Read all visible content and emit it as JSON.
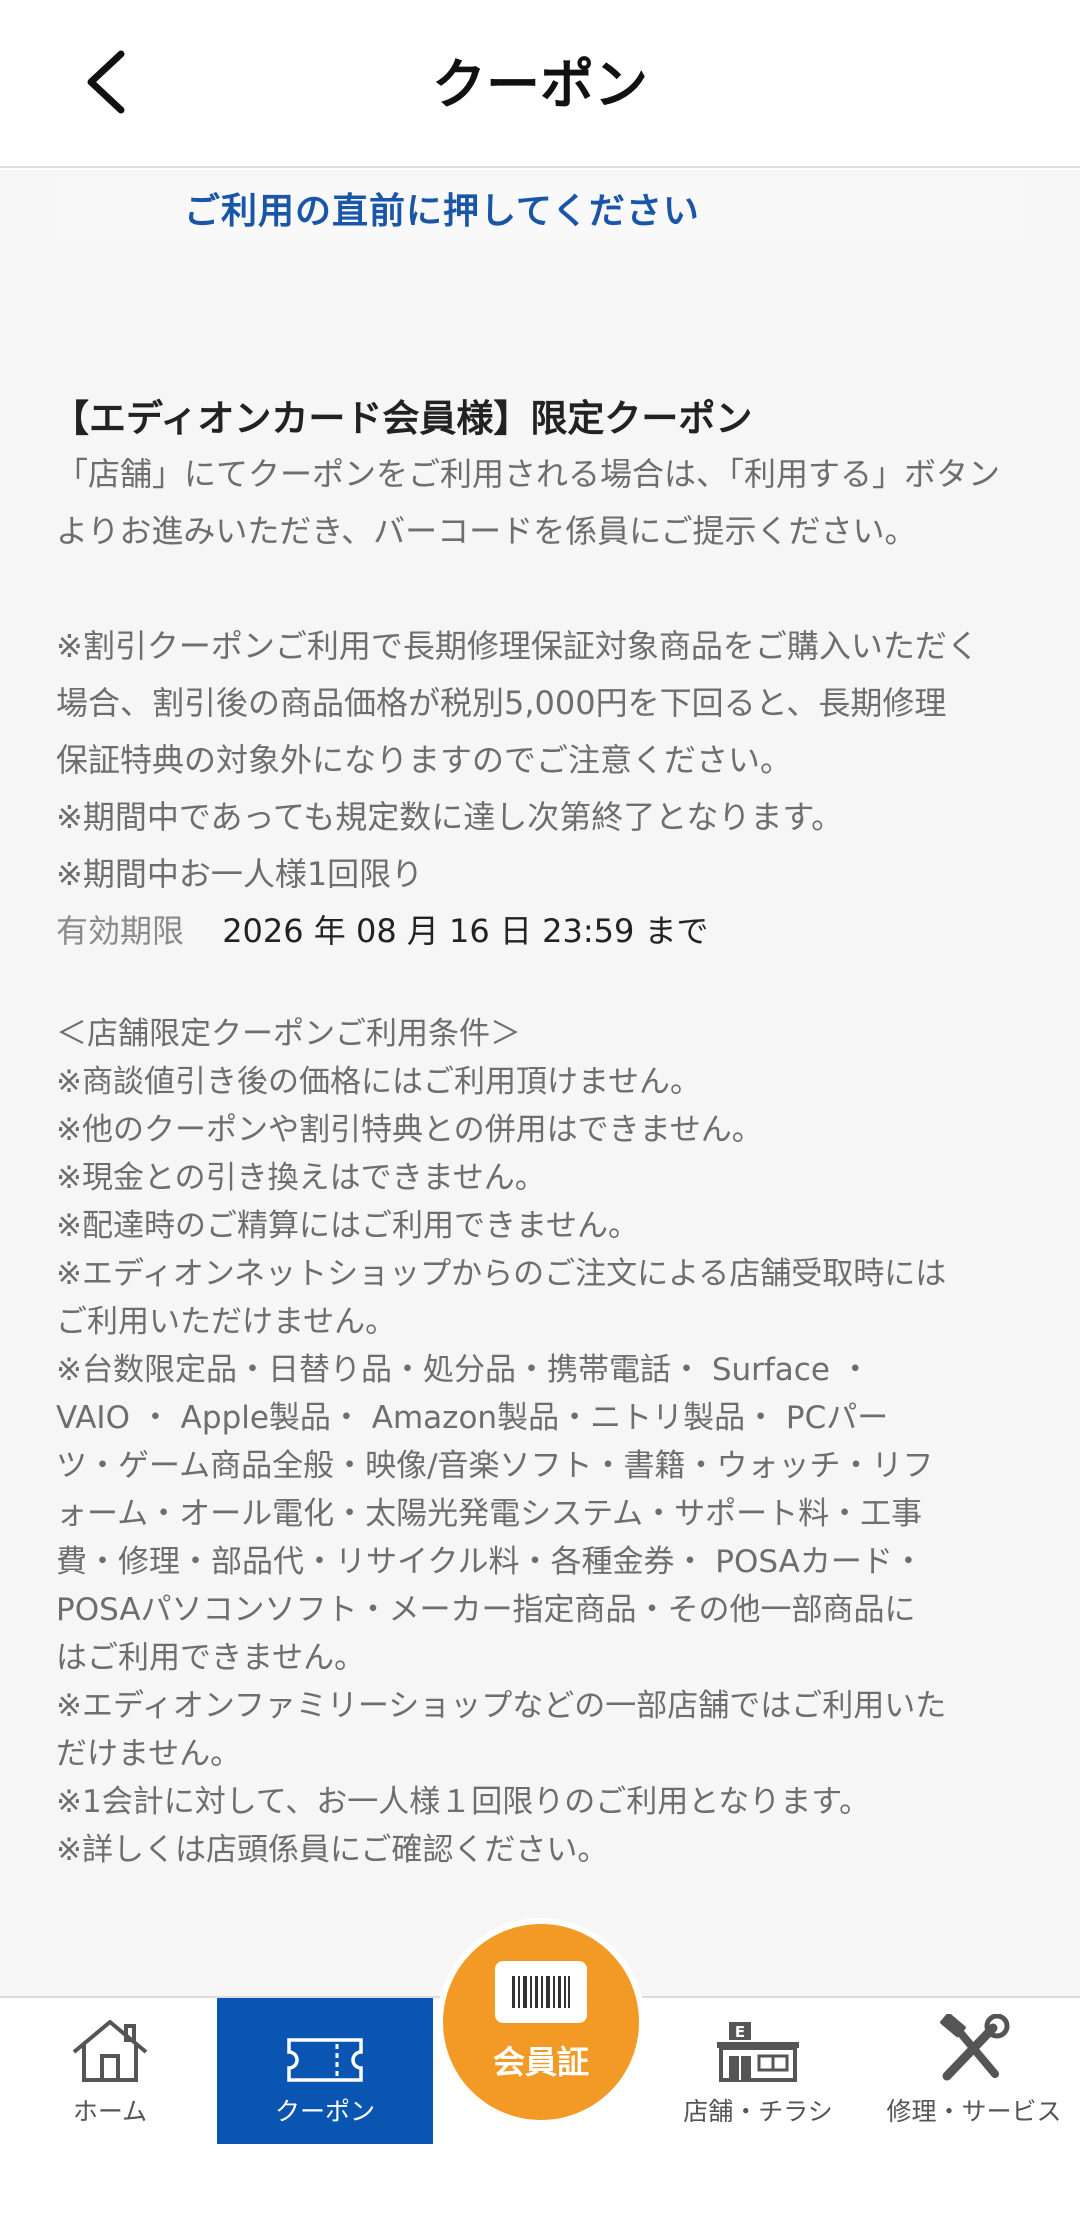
{
  "header": {
    "title": "クーポン",
    "back_icon": "chevron-left-icon"
  },
  "banner": {
    "text": "ご利用の直前に押してください"
  },
  "coupon": {
    "title": "【エディオンカード会員様】限定クーポン",
    "description_lines": [
      "「店舗」にてクーポンをご利用される場合は、「利用する」ボタン",
      "よりお進みいただき、バーコードを係員にご提示ください。"
    ],
    "notes_lines": [
      "※割引クーポンご利用で長期修理保証対象商品をご購入いただく",
      "場合、割引後の商品価格が税別5,000円を下回ると、長期修理",
      "保証特典の対象外になりますのでご注意ください。",
      "※期間中であっても規定数に達し次第終了となります。",
      "※期間中お一人様1回限り"
    ],
    "validity_label": "有効期限",
    "validity_value": "2026 年 08 月 16 日 23:59 まで"
  },
  "conditions": {
    "lines": [
      "＜店舗限定クーポンご利用条件＞",
      "※商談値引き後の価格にはご利用頂けません。",
      "※他のクーポンや割引特典との併用はできません。",
      "※現金との引き換えはできません。",
      "※配達時のご精算にはご利用できません。",
      "※エディオンネットショップからのご注文による店舗受取時には",
      "ご利用いただけません。",
      "※台数限定品・日替り品・処分品・携帯電話・ Surface ・",
      "VAIO ・ Apple製品・ Amazon製品・ニトリ製品・ PCパー",
      "ツ・ゲーム商品全般・映像/音楽ソフト・書籍・ウォッチ・リフ",
      "ォーム・オール電化・太陽光発電システム・サポート料・工事",
      "費・修理・部品代・リサイクル料・各種金券・ POSAカード・",
      "POSAパソコンソフト・メーカー指定商品・その他一部商品に",
      "はご利用できません。",
      "※エディオンファミリーショップなどの一部店舗ではご利用いた",
      "だけません。",
      "※1会計に対して、お一人様１回限りのご利用となります。",
      "※詳しくは店頭係員にご確認ください。"
    ]
  },
  "tabbar": {
    "home": {
      "label": "ホーム",
      "icon": "home-icon"
    },
    "coupon": {
      "label": "クーポン",
      "icon": "ticket-icon"
    },
    "member": {
      "label": "会員証",
      "icon": "barcode-card-icon"
    },
    "store": {
      "label": "店舗・チラシ",
      "icon": "store-icon"
    },
    "repair": {
      "label": "修理・サービス",
      "icon": "tools-icon"
    }
  },
  "colors": {
    "accent_blue": "#0a55b2",
    "banner_text": "#1a56a8",
    "member_orange": "#f39a26"
  }
}
